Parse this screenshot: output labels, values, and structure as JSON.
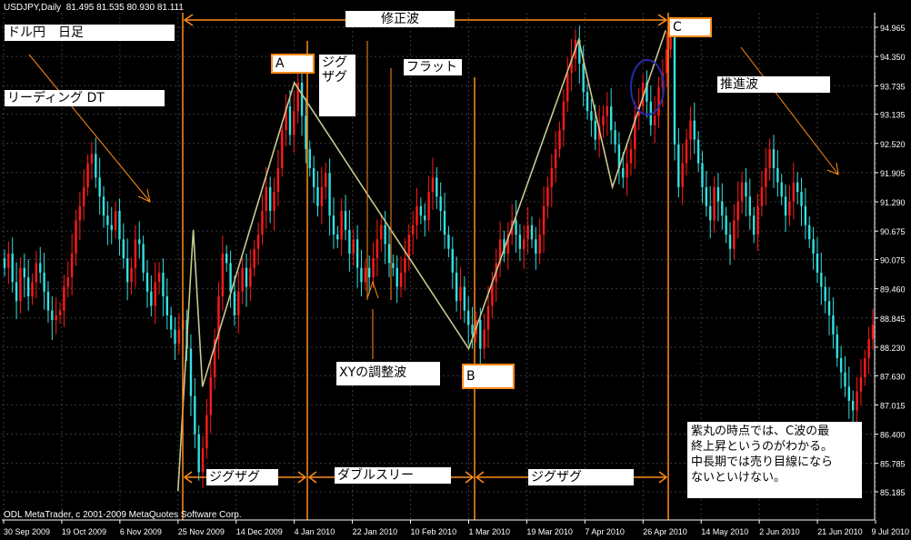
{
  "header": {
    "title": "USDJPY,Daily",
    "ohlc": "81.495 81.535 80.930 81.111"
  },
  "footer": "ODL MetaTrader, c 2001-2009 MetaQuotes Software Corp.",
  "colors": {
    "background": "#000000",
    "grid": "#3a3a3a",
    "up_candle": "#ff1a1a",
    "down_candle": "#33e0e0",
    "annotation": "#ff8c1a",
    "wave_line": "#c8c890",
    "circle": "#2a2aa8",
    "text": "#ffffff"
  },
  "annotations": {
    "correction_wave": "修正波",
    "pair_timeframe": "ドル円　日足",
    "leading_dt": "リーディング DT",
    "wave_a": "A",
    "zigzag_vertical": "ジグ\nザグ",
    "flat": "フラット",
    "impulse_wave": "推進波",
    "wave_c": "C",
    "xy_adjustment": "XYの調整波",
    "wave_b": "B",
    "zigzag_1": "ジグザグ",
    "double_three": "ダブルスリー",
    "zigzag_2": "ジグザグ",
    "note": "紫丸の時点では、C波の最\n終上昇というのがわかる。\n中長期では売り目線になら\nないといけない。"
  },
  "chart_data": {
    "type": "candlestick",
    "title": "USDJPY,Daily",
    "y_axis": {
      "ticks": [
        "94.965",
        "94.350",
        "93.735",
        "93.135",
        "92.520",
        "91.905",
        "91.290",
        "90.675",
        "90.075",
        "89.460",
        "88.845",
        "88.230",
        "87.630",
        "87.015",
        "86.400",
        "85.785",
        "85.185"
      ],
      "ylim": [
        84.9,
        95.6
      ]
    },
    "x_axis": {
      "ticks": [
        "30 Sep 2009",
        "19 Oct 2009",
        "6 Nov 2009",
        "25 Nov 2009",
        "14 Dec 2009",
        "4 Jan 2010",
        "22 Jan 2010",
        "10 Feb 2010",
        "1 Mar 2010",
        "19 Mar 2010",
        "7 Apr 2010",
        "26 Apr 2010",
        "14 May 2010",
        "2 Jun 2010",
        "21 Jun 2010",
        "9 Jul 2010"
      ]
    },
    "grid": true,
    "wave_path": [
      {
        "date": "25 Nov 2009",
        "price": 85.2
      },
      {
        "date": "30 Nov 2009",
        "price": 90.7
      },
      {
        "date": "3 Dec 2009",
        "price": 87.4
      },
      {
        "date": "4 Jan 2010",
        "price": 93.8
      },
      {
        "date": "1 Mar 2010",
        "price": 88.2
      },
      {
        "date": "5 Apr 2010",
        "price": 94.7
      },
      {
        "date": "16 Apr 2010",
        "price": 91.6
      },
      {
        "date": "3 May 2010",
        "price": 94.9
      }
    ],
    "series": [
      {
        "name": "",
        "closes": [
          89.9,
          90.2,
          89.6,
          89.2,
          89.9,
          89.7,
          89.3,
          89.6,
          90.0,
          89.8,
          89.4,
          89.0,
          88.8,
          88.9,
          89.0,
          89.5,
          89.7,
          90.2,
          90.9,
          91.2,
          91.6,
          92.1,
          92.3,
          91.8,
          91.4,
          91.0,
          90.8,
          90.7,
          91.1,
          90.5,
          90.1,
          89.6,
          89.9,
          90.5,
          90.4,
          89.8,
          89.4,
          89.1,
          89.6,
          89.8,
          89.3,
          88.9,
          88.6,
          88.3,
          88.6,
          88.8,
          88.2,
          87.2,
          86.4,
          85.6,
          86.1,
          86.8,
          87.6,
          88.4,
          89.3,
          90.2,
          90.0,
          89.4,
          88.9,
          89.4,
          89.9,
          89.5,
          89.9,
          90.3,
          90.6,
          91.1,
          91.6,
          91.1,
          91.5,
          92.0,
          92.8,
          93.3,
          92.7,
          93.2,
          93.8,
          93.1,
          92.4,
          92.0,
          91.6,
          91.2,
          91.6,
          91.9,
          91.0,
          90.6,
          90.5,
          91.1,
          90.7,
          90.2,
          90.5,
          89.9,
          89.6,
          89.9,
          89.7,
          90.1,
          90.5,
          90.8,
          90.4,
          90.0,
          89.9,
          89.5,
          89.8,
          90.1,
          90.6,
          90.8,
          91.2,
          91.0,
          90.9,
          91.5,
          91.8,
          91.4,
          91.1,
          90.6,
          90.3,
          89.8,
          89.2,
          89.5,
          89.0,
          88.7,
          88.5,
          88.8,
          88.2,
          88.6,
          89.1,
          89.6,
          90.0,
          90.5,
          90.2,
          90.6,
          90.9,
          90.6,
          90.3,
          90.5,
          90.8,
          90.5,
          90.2,
          90.6,
          91.2,
          91.6,
          92.0,
          92.4,
          92.8,
          93.4,
          94.0,
          94.3,
          94.7,
          94.2,
          93.6,
          93.2,
          93.0,
          92.6,
          92.9,
          93.1,
          93.3,
          92.8,
          92.5,
          92.0,
          91.8,
          92.1,
          92.4,
          93.1,
          93.3,
          93.8,
          93.4,
          92.9,
          93.1,
          93.7,
          94.0,
          94.5,
          94.9,
          92.5,
          91.6,
          92.1,
          92.6,
          93.0,
          92.6,
          92.1,
          91.6,
          91.2,
          90.9,
          91.6,
          91.3,
          91.0,
          90.6,
          90.3,
          90.9,
          91.3,
          91.7,
          91.4,
          91.0,
          90.6,
          91.2,
          91.6,
          92.0,
          92.4,
          92.0,
          91.7,
          91.4,
          91.0,
          91.3,
          91.7,
          91.5,
          91.2,
          90.8,
          90.5,
          90.2,
          89.8,
          89.5,
          89.2,
          88.9,
          88.5,
          88.0,
          87.7,
          87.4,
          87.1,
          86.9,
          87.3,
          87.6,
          88.0,
          88.4,
          88.7
        ]
      }
    ]
  }
}
